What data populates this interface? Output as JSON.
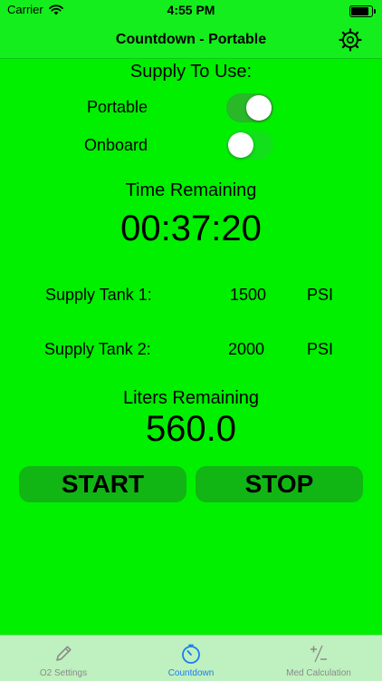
{
  "status_bar": {
    "carrier": "Carrier",
    "time": "4:55 PM"
  },
  "nav": {
    "title": "Countdown - Portable"
  },
  "supply": {
    "heading": "Supply To Use:",
    "options": [
      {
        "label": "Portable",
        "on": true
      },
      {
        "label": "Onboard",
        "on": false
      }
    ]
  },
  "timer": {
    "heading": "Time Remaining",
    "value": "00:37:20"
  },
  "tanks": [
    {
      "label": "Supply Tank 1:",
      "value": "1500",
      "unit": "PSI"
    },
    {
      "label": "Supply Tank 2:",
      "value": "2000",
      "unit": "PSI"
    }
  ],
  "liters": {
    "heading": "Liters Remaining",
    "value": "560.0"
  },
  "buttons": {
    "start": "START",
    "stop": "STOP"
  },
  "tabs": [
    {
      "label": "O2 Settings",
      "icon": "pencil-icon",
      "active": false
    },
    {
      "label": "Countdown",
      "icon": "stopwatch-icon",
      "active": true
    },
    {
      "label": "Med Calculation",
      "icon": "plus-minus-icon",
      "active": false
    }
  ],
  "colors": {
    "background": "#00f000",
    "button": "#12b614",
    "tab_active": "#1a7cf0",
    "tab_inactive": "#8a8a8a"
  }
}
